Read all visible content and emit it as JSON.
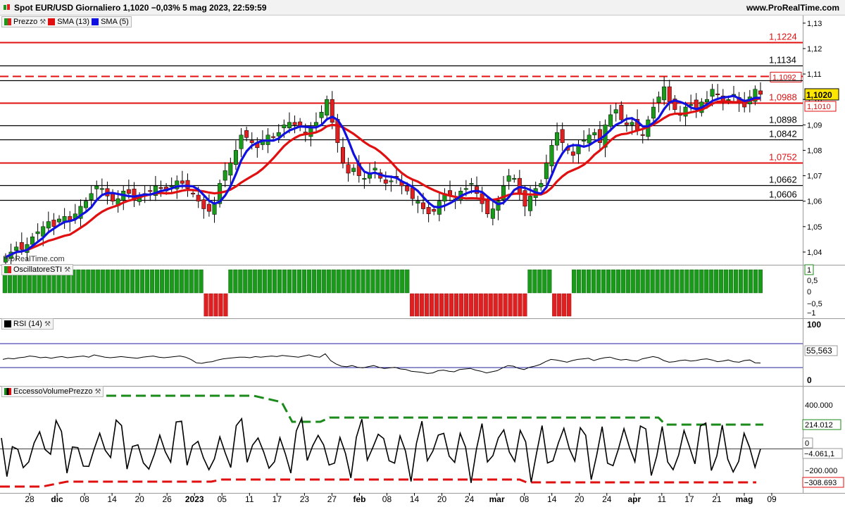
{
  "header": {
    "title": "Spot EUR/USD Giornaliero 1,1020 −0,03% 5 mag 2023, 22:59:59",
    "site": "www.ProRealTime.com"
  },
  "legend": {
    "price": "Prezzo",
    "sma13": "SMA (13)",
    "sma5": "SMA (5)",
    "sti": "OscillatoreSTI",
    "rsi": "RSI (14)",
    "vol": "EccessoVolumePrezzo"
  },
  "watermark": "ProRealTime.com",
  "colors": {
    "up": "#1a9a1a",
    "down": "#e02020",
    "sma13": "#e01010",
    "sma5": "#1010e0",
    "green_dash": "#1a8a1a",
    "red_dash": "#e01010"
  },
  "chart_data": [
    {
      "type": "candlestick",
      "title": "Spot EUR/USD Giornaliero",
      "last_price": "1,1020",
      "change": "−0,03%",
      "ylim": [
        1.035,
        1.133
      ],
      "y_ticks": [
        "1,13",
        "1,12",
        "1,11",
        "1,10",
        "1,09",
        "1,08",
        "1,07",
        "1,06",
        "1,05",
        "1,04"
      ],
      "x_labels": [
        "28",
        "dic",
        "08",
        "14",
        "20",
        "26",
        "2023",
        "05",
        "11",
        "17",
        "23",
        "27",
        "feb",
        "08",
        "14",
        "20",
        "24",
        "mar",
        "08",
        "14",
        "20",
        "24",
        "apr",
        "11",
        "17",
        "21",
        "mag",
        "09"
      ],
      "horizontal_levels": [
        {
          "value": 1.1224,
          "label": "1,1224",
          "color": "red"
        },
        {
          "value": 1.1134,
          "label": "1,1134",
          "color": "black"
        },
        {
          "value": 1.1092,
          "label": "1,1092",
          "color": "red",
          "style": "dashed"
        },
        {
          "value": 1.1075,
          "label": "",
          "color": "black"
        },
        {
          "value": 1.0988,
          "label": "1,0988",
          "color": "red"
        },
        {
          "value": 1.0898,
          "label": "1,0898",
          "color": "black"
        },
        {
          "value": 1.0842,
          "label": "1,0842",
          "color": "black"
        },
        {
          "value": 1.0752,
          "label": "1,0752",
          "color": "red"
        },
        {
          "value": 1.0662,
          "label": "1,0662",
          "color": "black"
        },
        {
          "value": 1.0606,
          "label": "1,0606",
          "color": "black"
        }
      ],
      "price_badges": [
        {
          "value": "1,1020",
          "kind": "last"
        },
        {
          "value": "1,1010",
          "kind": "sma13"
        }
      ],
      "series_close": [
        1.038,
        1.04,
        1.042,
        1.041,
        1.043,
        1.046,
        1.048,
        1.05,
        1.052,
        1.05,
        1.053,
        1.054,
        1.052,
        1.055,
        1.058,
        1.06,
        1.063,
        1.066,
        1.065,
        1.062,
        1.06,
        1.061,
        1.064,
        1.063,
        1.061,
        1.062,
        1.063,
        1.064,
        1.066,
        1.065,
        1.064,
        1.066,
        1.068,
        1.067,
        1.065,
        1.063,
        1.06,
        1.057,
        1.056,
        1.059,
        1.067,
        1.072,
        1.075,
        1.08,
        1.086,
        1.085,
        1.083,
        1.081,
        1.084,
        1.086,
        1.085,
        1.087,
        1.09,
        1.091,
        1.09,
        1.089,
        1.086,
        1.089,
        1.091,
        1.095,
        1.1,
        1.091,
        1.083,
        1.075,
        1.071,
        1.073,
        1.07,
        1.069,
        1.071,
        1.073,
        1.069,
        1.067,
        1.068,
        1.069,
        1.066,
        1.064,
        1.061,
        1.06,
        1.057,
        1.055,
        1.056,
        1.06,
        1.063,
        1.062,
        1.061,
        1.064,
        1.065,
        1.067,
        1.063,
        1.059,
        1.055,
        1.057,
        1.06,
        1.066,
        1.07,
        1.069,
        1.063,
        1.058,
        1.062,
        1.065,
        1.067,
        1.075,
        1.082,
        1.087,
        1.083,
        1.08,
        1.078,
        1.082,
        1.084,
        1.086,
        1.087,
        1.083,
        1.09,
        1.094,
        1.096,
        1.092,
        1.09,
        1.091,
        1.088,
        1.086,
        1.092,
        1.097,
        1.101,
        1.105,
        1.099,
        1.096,
        1.094,
        1.097,
        1.098,
        1.096,
        1.099,
        1.1,
        1.104,
        1.102,
        1.099,
        1.1,
        1.102,
        1.099,
        1.097,
        1.101,
        1.104,
        1.102
      ],
      "sma13_color": "red",
      "sma5_color": "blue"
    },
    {
      "type": "bar",
      "title": "OscillatoreSTI",
      "y_ticks": [
        "1",
        "0,5",
        "0",
        "−0,5",
        "−1"
      ],
      "badge": "1",
      "signal": [
        1,
        1,
        1,
        1,
        1,
        1,
        1,
        1,
        1,
        1,
        1,
        1,
        1,
        1,
        1,
        1,
        1,
        1,
        1,
        1,
        1,
        1,
        1,
        1,
        1,
        1,
        1,
        1,
        1,
        1,
        1,
        1,
        1,
        1,
        1,
        1,
        1,
        1,
        1,
        1,
        1,
        -1,
        -1,
        -1,
        -1,
        -1,
        1,
        1,
        1,
        1,
        1,
        1,
        1,
        1,
        1,
        1,
        1,
        1,
        1,
        1,
        1,
        1,
        1,
        1,
        1,
        1,
        1,
        1,
        1,
        1,
        1,
        1,
        1,
        1,
        1,
        1,
        1,
        1,
        1,
        1,
        1,
        1,
        1,
        -1,
        -1,
        -1,
        -1,
        -1,
        -1,
        -1,
        -1,
        -1,
        -1,
        -1,
        -1,
        -1,
        -1,
        -1,
        -1,
        -1,
        -1,
        -1,
        -1,
        -1,
        -1,
        -1,
        -1,
        1,
        1,
        1,
        1,
        1,
        -1,
        -1,
        -1,
        -1,
        1,
        1,
        1,
        1,
        1,
        1,
        1,
        1,
        1,
        1,
        1,
        1,
        1,
        1,
        1,
        1,
        1,
        1,
        1,
        1,
        1,
        1,
        1,
        1,
        1,
        1,
        1,
        1,
        1,
        1,
        1,
        1,
        1,
        1,
        1,
        1,
        1,
        1,
        1
      ]
    },
    {
      "type": "line",
      "title": "RSI (14)",
      "y_ticks": [
        "100",
        "0"
      ],
      "upper_level": 70,
      "lower_level": 30,
      "last_value": "55,563",
      "values": [
        62,
        64,
        63,
        65,
        66,
        68,
        67,
        65,
        66,
        64,
        66,
        67,
        65,
        66,
        67,
        68,
        66,
        70,
        68,
        66,
        65,
        66,
        67,
        66,
        65,
        64,
        66,
        67,
        68,
        66,
        65,
        66,
        67,
        68,
        66,
        62,
        56,
        55,
        57,
        58,
        61,
        63,
        64,
        65,
        66,
        66,
        65,
        67,
        66,
        67,
        68,
        67,
        69,
        68,
        67,
        66,
        68,
        70,
        67,
        66,
        72,
        60,
        54,
        50,
        49,
        51,
        48,
        47,
        49,
        51,
        48,
        46,
        47,
        48,
        45,
        44,
        41,
        40,
        39,
        37,
        38,
        42,
        43,
        41,
        40,
        44,
        45,
        46,
        43,
        41,
        38,
        40,
        42,
        47,
        51,
        50,
        46,
        44,
        48,
        50,
        53,
        58,
        62,
        61,
        59,
        57,
        60,
        62,
        63,
        64,
        60,
        63,
        65,
        66,
        63,
        61,
        62,
        60,
        59,
        63,
        65,
        67,
        65,
        60,
        57,
        58,
        60,
        61,
        59,
        60,
        62,
        63,
        61,
        58,
        59,
        61,
        58,
        57,
        60,
        61,
        56,
        55.563
      ]
    },
    {
      "type": "line",
      "title": "EccessoVolumePrezzo",
      "y_ticks": [
        "400.000",
        "0",
        "−200.000"
      ],
      "badges": [
        "214.012",
        "0",
        "−4.061,1",
        "−308.693"
      ],
      "upper_band_last": 214012,
      "lower_band_last": -308693,
      "last_value": -4061.1
    }
  ]
}
